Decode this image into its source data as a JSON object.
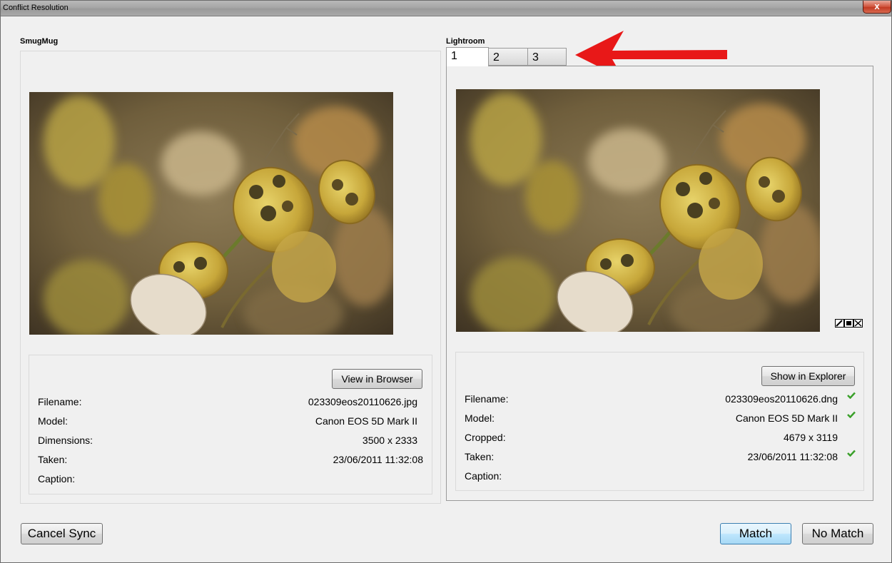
{
  "window": {
    "title": "Conflict Resolution",
    "close_glyph": "x"
  },
  "smugmug": {
    "heading": "SmugMug",
    "view_button": "View in Browser",
    "fields": [
      {
        "label": "Filename:",
        "value": "023309eos20110626.jpg"
      },
      {
        "label": "Model:",
        "value": "Canon EOS 5D Mark II"
      },
      {
        "label": "Dimensions:",
        "value": "3500 x 2333"
      },
      {
        "label": "Taken:",
        "value": "23/06/2011 11:32:08"
      },
      {
        "label": "Caption:",
        "value": ""
      }
    ]
  },
  "lightroom": {
    "heading": "Lightroom",
    "tabs": [
      "1",
      "2",
      "3"
    ],
    "active_tab": "1",
    "show_button": "Show in Explorer",
    "fields": [
      {
        "label": "Filename:",
        "value": "023309eos20110626.dng",
        "match": true
      },
      {
        "label": "Model:",
        "value": "Canon EOS 5D Mark II",
        "match": true
      },
      {
        "label": "Cropped:",
        "value": "4679 x 3119",
        "match": false
      },
      {
        "label": "Taken:",
        "value": "23/06/2011 11:32:08",
        "match": true
      },
      {
        "label": "Caption:",
        "value": "",
        "match": false
      }
    ]
  },
  "footer": {
    "cancel": "Cancel Sync",
    "match": "Match",
    "no_match": "No Match"
  },
  "colors": {
    "arrow": "#e81818",
    "check": "#3aa02a",
    "dialog_bg": "#f0f0f0"
  },
  "icons": [
    "close-icon",
    "check-icon",
    "red-arrow-annotation",
    "metadata-status-icons"
  ]
}
